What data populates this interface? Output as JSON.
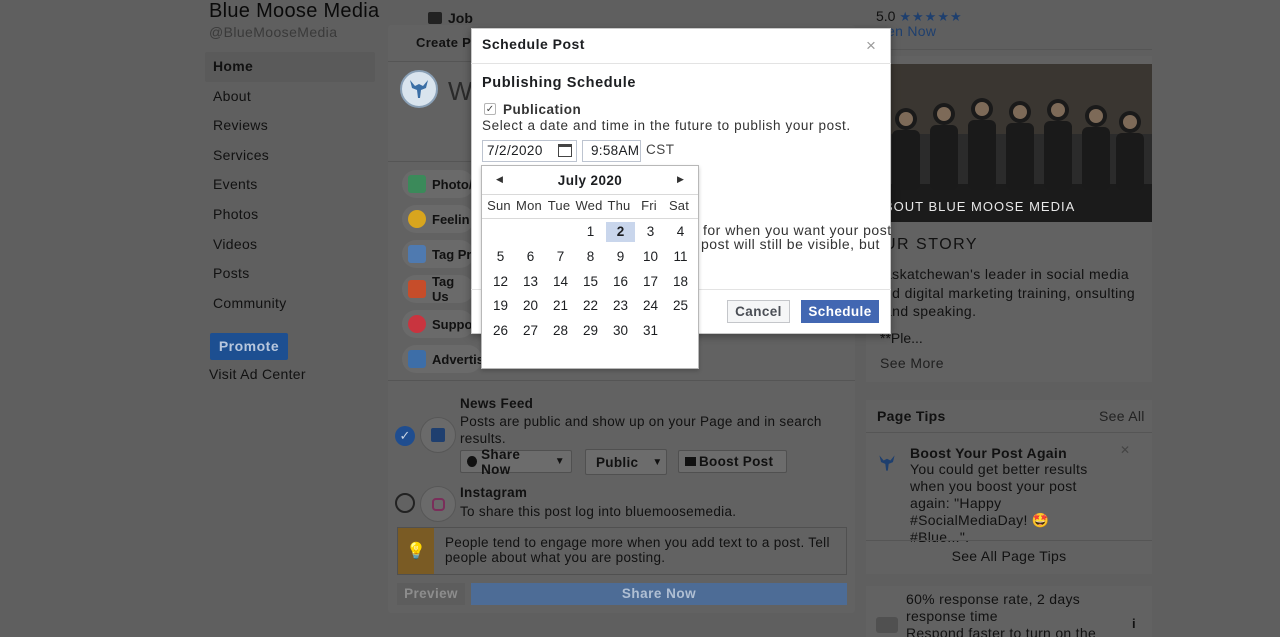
{
  "page": {
    "name": "Blue Moose Media",
    "handle": "@BlueMooseMedia"
  },
  "left_nav": {
    "items": [
      {
        "label": "Home"
      },
      {
        "label": "About"
      },
      {
        "label": "Reviews"
      },
      {
        "label": "Services"
      },
      {
        "label": "Events"
      },
      {
        "label": "Photos"
      },
      {
        "label": "Videos"
      },
      {
        "label": "Posts"
      },
      {
        "label": "Community"
      }
    ],
    "promote_label": "Promote",
    "ad_center_label": "Visit Ad Center"
  },
  "composer": {
    "job_label": "Job",
    "tab_label": "Create P",
    "write_placeholder": "Wr",
    "options": [
      {
        "label": "Photo/",
        "icon": "photo-icon",
        "color": "#3b8a5a"
      },
      {
        "label": "Feelin",
        "icon": "feeling-icon",
        "color": "#d8a51e"
      },
      {
        "label": "Tag Pr",
        "icon": "tag-products-icon",
        "color": "#4f7ab0"
      },
      {
        "label": "Tag Us",
        "icon": "tag-users-icon",
        "color": "#c64d2a"
      },
      {
        "label": "Suppo",
        "icon": "support-icon",
        "color": "#c9343f"
      },
      {
        "label": "Advertis",
        "icon": "advertise-icon",
        "color": "#3d6ea8"
      }
    ],
    "news_feed": {
      "title": "News Feed",
      "description": "Posts are public and show up on your Page and in search results.",
      "share_select": "Share Now",
      "audience_select": "Public",
      "boost_label": "Boost Post"
    },
    "instagram": {
      "title": "Instagram",
      "description": "To share this post log into bluemoosemedia."
    },
    "tip": "People tend to engage more when you add text to a post. Tell people about what you are posting.",
    "preview_label": "Preview",
    "share_now_label": "Share Now"
  },
  "right_column": {
    "rating_value": "5.0",
    "rating_stars": "★★★★★",
    "listen_now": "en Now",
    "about_caption": "BOUT BLUE MOOSE MEDIA",
    "our_story_title": "UR STORY",
    "story_text": "askatchewan's leader in social media nd digital marketing training, onsulting and speaking.",
    "story_more": "**Ple...",
    "see_more": "See More",
    "page_tips_title": "Page Tips",
    "page_tips_see_all": "See All",
    "tip_title": "Boost Your Post Again",
    "tip_body": "You could get better results when you boost your post again: \"Happy #SocialMediaDay! 🤩 #Blue...\".",
    "see_all_tips": "See All Page Tips",
    "response_text": "60% response rate, 2 days response time",
    "response_sub": "Respond faster to turn on the"
  },
  "dialog": {
    "title": "Schedule Post",
    "section_title": "Publishing Schedule",
    "publication_label": "Publication",
    "publication_checked": true,
    "publication_desc": "Select a date and time in the future to publish your post.",
    "date_value": "7/2/2020",
    "time_value": "9:58AM",
    "timezone": "CST",
    "obscured_line1": "for when you want your post",
    "obscured_line2": "post will still be visible, but",
    "cancel_label": "Cancel",
    "schedule_label": "Schedule"
  },
  "calendar": {
    "month_label": "July 2020",
    "weekdays": [
      "Sun",
      "Mon",
      "Tue",
      "Wed",
      "Thu",
      "Fri",
      "Sat"
    ],
    "weeks": [
      [
        "",
        "",
        "",
        "1",
        "2",
        "3",
        "4"
      ],
      [
        "5",
        "6",
        "7",
        "8",
        "9",
        "10",
        "11"
      ],
      [
        "12",
        "13",
        "14",
        "15",
        "16",
        "17",
        "18"
      ],
      [
        "19",
        "20",
        "21",
        "22",
        "23",
        "24",
        "25"
      ],
      [
        "26",
        "27",
        "28",
        "29",
        "30",
        "31",
        ""
      ]
    ],
    "selected_day": "2"
  },
  "colors": {
    "accent": "#4267b2",
    "selected_day_bg": "#c9d6ec",
    "overlay": "#5f5f5f"
  }
}
